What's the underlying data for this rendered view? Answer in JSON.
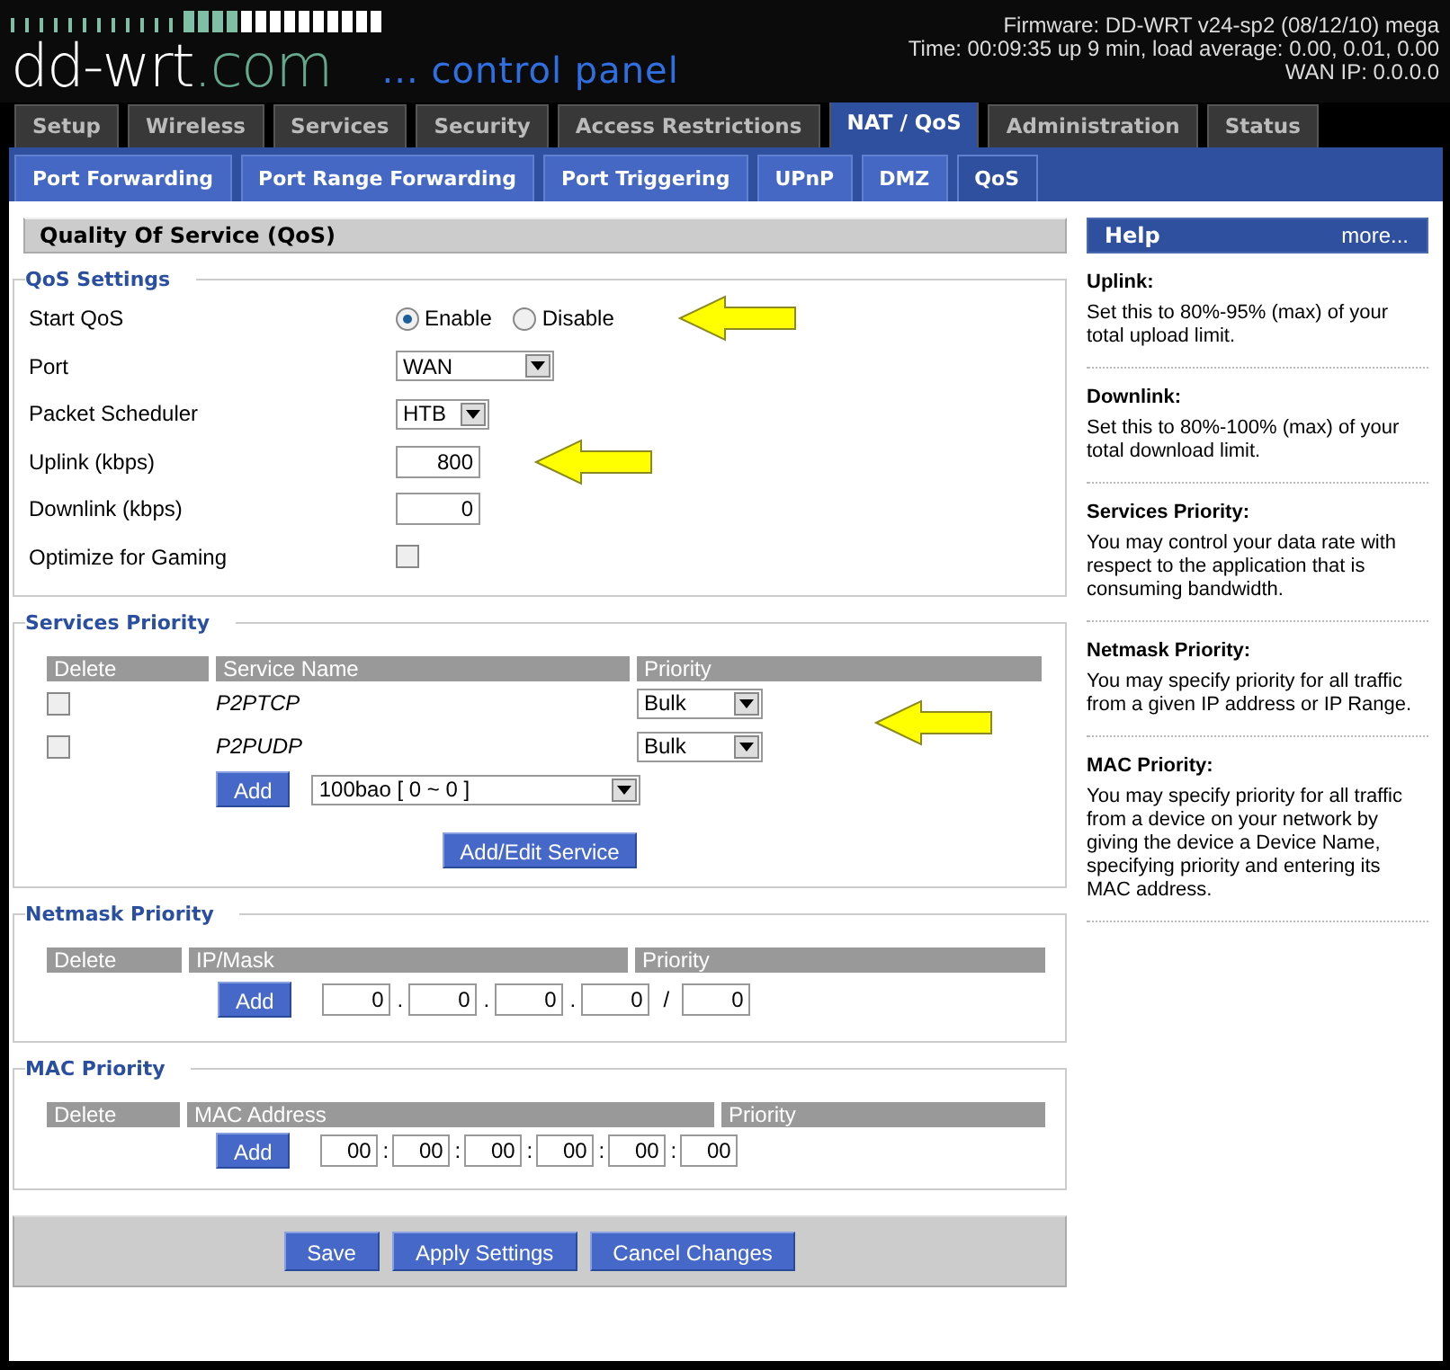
{
  "header": {
    "logo_main": "dd-wrt",
    "logo_suffix": ".com",
    "tagline": "... control panel",
    "info": [
      "Firmware: DD-WRT v24-sp2 (08/12/10) mega",
      "Time: 00:09:35 up 9 min, load average: 0.00, 0.01, 0.00",
      "WAN IP: 0.0.0.0"
    ]
  },
  "tabs": [
    {
      "label": "Setup",
      "selected": false
    },
    {
      "label": "Wireless",
      "selected": false
    },
    {
      "label": "Services",
      "selected": false
    },
    {
      "label": "Security",
      "selected": false
    },
    {
      "label": "Access Restrictions",
      "selected": false
    },
    {
      "label": "NAT / QoS",
      "selected": true
    },
    {
      "label": "Administration",
      "selected": false
    },
    {
      "label": "Status",
      "selected": false
    }
  ],
  "subtabs": [
    {
      "label": "Port Forwarding",
      "selected": false
    },
    {
      "label": "Port Range Forwarding",
      "selected": false
    },
    {
      "label": "Port Triggering",
      "selected": false
    },
    {
      "label": "UPnP",
      "selected": false
    },
    {
      "label": "DMZ",
      "selected": false
    },
    {
      "label": "QoS",
      "selected": true
    }
  ],
  "page_title": "Quality Of Service (QoS)",
  "qos_settings": {
    "title": "QoS Settings",
    "rows": [
      {
        "kind": "radio",
        "label": "Start QoS",
        "options": [
          {
            "label": "Enable",
            "selected": true
          },
          {
            "label": "Disable",
            "selected": false
          }
        ],
        "annotated": true
      },
      {
        "kind": "select",
        "label": "Port",
        "value": "WAN",
        "wide": true
      },
      {
        "kind": "select",
        "label": "Packet Scheduler",
        "value": "HTB",
        "wide": false
      },
      {
        "kind": "text",
        "label": "Uplink (kbps)",
        "value": "800",
        "annotated": true
      },
      {
        "kind": "text",
        "label": "Downlink (kbps)",
        "value": "0"
      },
      {
        "kind": "checkbox",
        "label": "Optimize for Gaming",
        "checked": false
      }
    ]
  },
  "services_priority": {
    "title": "Services Priority",
    "columns": [
      "Delete",
      "Service Name",
      "Priority"
    ],
    "rows": [
      {
        "checked": false,
        "name": "P2PTCP",
        "priority": "Bulk"
      },
      {
        "checked": false,
        "name": "P2PUDP",
        "priority": "Bulk"
      }
    ],
    "add_button": "Add",
    "service_select": "100bao [ 0 ~ 0 ]",
    "edit_button": "Add/Edit Service"
  },
  "netmask_priority": {
    "title": "Netmask Priority",
    "columns": [
      "Delete",
      "IP/Mask",
      "Priority"
    ],
    "add_button": "Add",
    "octets": [
      "0",
      "0",
      "0",
      "0"
    ],
    "dot": ".",
    "slash": "/",
    "mask": "0"
  },
  "mac_priority": {
    "title": "MAC Priority",
    "columns": [
      "Delete",
      "MAC Address",
      "Priority"
    ],
    "add_button": "Add",
    "separator": ":",
    "bytes": [
      "00",
      "00",
      "00",
      "00",
      "00",
      "00"
    ]
  },
  "buttons": [
    "Save",
    "Apply Settings",
    "Cancel Changes"
  ],
  "help": {
    "title": "Help",
    "more": "more...",
    "items": [
      {
        "heading": "Uplink:",
        "text": "Set this to 80%-95% (max) of your total upload limit."
      },
      {
        "heading": "Downlink:",
        "text": "Set this to 80%-100% (max) of your total download limit."
      },
      {
        "heading": "Services Priority:",
        "text": "You may control your data rate with respect to the application that is consuming bandwidth."
      },
      {
        "heading": "Netmask Priority:",
        "text": "You may specify priority for all traffic from a given IP address or IP Range."
      },
      {
        "heading": "MAC Priority:",
        "text": "You may specify priority for all traffic from a device on your network by giving the device a Device Name, specifying priority and entering its MAC address."
      }
    ]
  }
}
